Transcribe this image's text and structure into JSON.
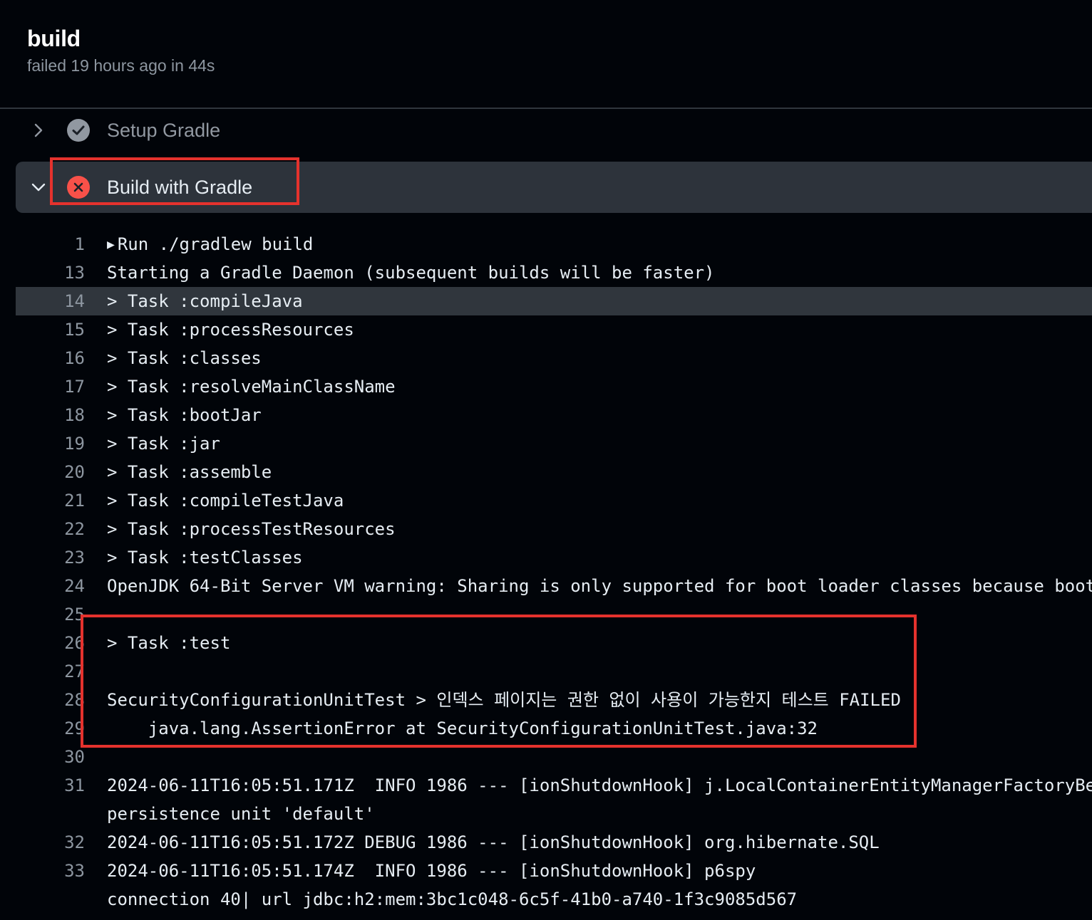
{
  "job": {
    "title": "build",
    "meta": "failed 19 hours ago in 44s"
  },
  "steps": [
    {
      "name": "Setup Gradle",
      "status": "success",
      "expanded": false,
      "icon": "check-circle-icon"
    },
    {
      "name": "Build with Gradle",
      "status": "failure",
      "expanded": true,
      "icon": "x-circle-icon"
    }
  ],
  "log": [
    {
      "num": "1",
      "text": "Run ./gradlew build",
      "collapsible": true
    },
    {
      "num": "13",
      "text": "Starting a Gradle Daemon (subsequent builds will be faster)"
    },
    {
      "num": "14",
      "text": "> Task :compileJava",
      "highlighted": true
    },
    {
      "num": "15",
      "text": "> Task :processResources"
    },
    {
      "num": "16",
      "text": "> Task :classes"
    },
    {
      "num": "17",
      "text": "> Task :resolveMainClassName"
    },
    {
      "num": "18",
      "text": "> Task :bootJar"
    },
    {
      "num": "19",
      "text": "> Task :jar"
    },
    {
      "num": "20",
      "text": "> Task :assemble"
    },
    {
      "num": "21",
      "text": "> Task :compileTestJava"
    },
    {
      "num": "22",
      "text": "> Task :processTestResources"
    },
    {
      "num": "23",
      "text": "> Task :testClasses"
    },
    {
      "num": "24",
      "text": "OpenJDK 64-Bit Server VM warning: Sharing is only supported for boot loader classes because boot"
    },
    {
      "num": "25",
      "text": ""
    },
    {
      "num": "26",
      "text": "> Task :test"
    },
    {
      "num": "27",
      "text": ""
    },
    {
      "num": "28",
      "text": "SecurityConfigurationUnitTest > 인덱스 페이지는 권한 없이 사용이 가능한지 테스트 FAILED"
    },
    {
      "num": "29",
      "text": "    java.lang.AssertionError at SecurityConfigurationUnitTest.java:32"
    },
    {
      "num": "30",
      "text": ""
    },
    {
      "num": "31",
      "text": "2024-06-11T16:05:51.171Z  INFO 1986 --- [ionShutdownHook] j.LocalContainerEntityManagerFactoryBe"
    },
    {
      "num": "",
      "text": "persistence unit 'default'"
    },
    {
      "num": "32",
      "text": "2024-06-11T16:05:51.172Z DEBUG 1986 --- [ionShutdownHook] org.hibernate.SQL"
    },
    {
      "num": "33",
      "text": "2024-06-11T16:05:51.174Z  INFO 1986 --- [ionShutdownHook] p6spy"
    },
    {
      "num": "",
      "text": "connection 40| url jdbc:h2:mem:3bc1c048-6c5f-41b0-a740-1f3c9085d567"
    }
  ],
  "colors": {
    "background": "#010409",
    "failure": "#f85149",
    "annotation": "#e5322d",
    "muted": "#8d96a0"
  }
}
